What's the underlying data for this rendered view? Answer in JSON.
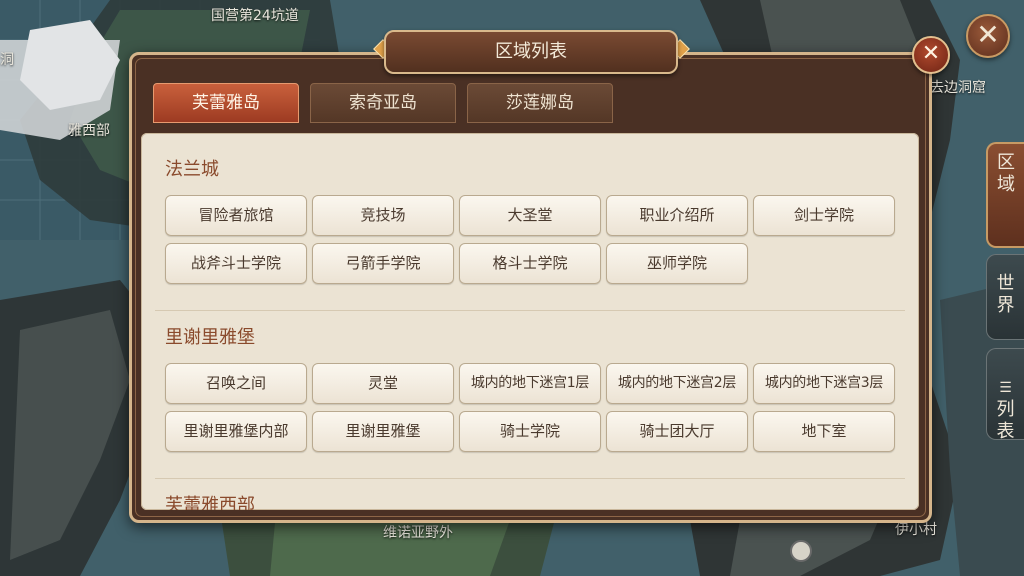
{
  "map": {
    "labels": [
      "国营第24坑道",
      "洞",
      "雅西部",
      "去边洞窟",
      "维诺亚野外",
      "伊小村"
    ]
  },
  "dialog": {
    "title": "区域列表",
    "close_icon": "close-icon",
    "tabs": [
      {
        "label": "芙蕾雅岛",
        "active": true
      },
      {
        "label": "索奇亚岛",
        "active": false
      },
      {
        "label": "莎莲娜岛",
        "active": false
      }
    ],
    "sections": [
      {
        "title": "法兰城",
        "buttons": [
          "冒险者旅馆",
          "竞技场",
          "大圣堂",
          "职业介绍所",
          "剑士学院",
          "战斧斗士学院",
          "弓箭手学院",
          "格斗士学院",
          "巫师学院"
        ]
      },
      {
        "title": "里谢里雅堡",
        "buttons": [
          "召唤之间",
          "灵堂",
          "城内的地下迷宫1层",
          "城内的地下迷宫2层",
          "城内的地下迷宫3层",
          "里谢里雅堡内部",
          "里谢里雅堡",
          "骑士学院",
          "骑士团大厅",
          "地下室"
        ]
      },
      {
        "title": "芙蕾雅西部"
      }
    ]
  },
  "top_close_icon": "close-icon",
  "side_tabs": [
    {
      "label_1": "区",
      "label_2": "域",
      "active": true
    },
    {
      "label_1": "世",
      "label_2": "界",
      "active": false
    },
    {
      "icon": "list-icon",
      "label_1": "列",
      "label_2": "表",
      "active": false
    }
  ],
  "colors": {
    "accent": "#c9603c",
    "section_title": "#8a4a2c",
    "panel": "#ebe3d3",
    "frame": "#4a3024",
    "gold_border": "#d5b58b"
  }
}
